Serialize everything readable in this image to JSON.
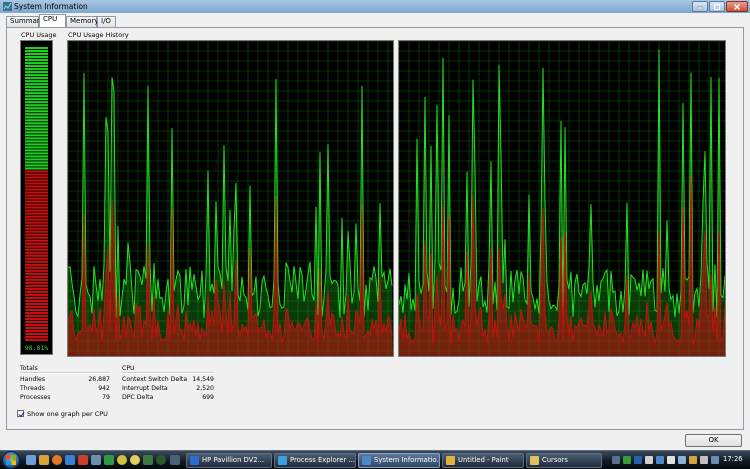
{
  "window": {
    "title": "System Information",
    "colors": {
      "gauge_green": "#1fd11f",
      "gauge_red": "#c80e0e",
      "graph_grid": "#0b5a0b",
      "graph_green": "#22e322",
      "graph_red": "#c81010"
    }
  },
  "tabs": [
    {
      "label": "Summary",
      "active": false
    },
    {
      "label": "CPU",
      "active": true
    },
    {
      "label": "Memory",
      "active": false
    },
    {
      "label": "I/O",
      "active": false
    }
  ],
  "cpu_usage": {
    "label": "CPU Usage",
    "value_text": "98.81%",
    "value": 98.81,
    "green_fraction": 0.42
  },
  "history": {
    "label": "CPU Usage History"
  },
  "totals": {
    "header": "Totals",
    "rows": [
      {
        "label": "Handles",
        "value": "26,887"
      },
      {
        "label": "Threads",
        "value": "942"
      },
      {
        "label": "Processes",
        "value": "79"
      }
    ]
  },
  "cpu_stats": {
    "header": "CPU",
    "rows": [
      {
        "label": "Context Switch Delta",
        "value": "14,549"
      },
      {
        "label": "Interrupt Delta",
        "value": "2,520"
      },
      {
        "label": "DPC Delta",
        "value": "699"
      }
    ]
  },
  "options": {
    "one_graph_per_cpu_label": "Show one graph per CPU",
    "one_graph_per_cpu_checked": true
  },
  "ok_label": "OK",
  "taskbar": {
    "tasks": [
      {
        "label": "HP Pavillion DV2...",
        "active": false,
        "icon_color": "#2a6fd0"
      },
      {
        "label": "Process Explorer ...",
        "active": false,
        "icon_color": "#3b9fe0"
      },
      {
        "label": "System Informatio...",
        "active": true,
        "icon_color": "#4f88c8"
      },
      {
        "label": "Untitled - Paint",
        "active": false,
        "icon_color": "#e0b040"
      },
      {
        "label": "Cursors",
        "active": false,
        "icon_color": "#e0c060"
      }
    ],
    "clock": "17:26"
  }
}
